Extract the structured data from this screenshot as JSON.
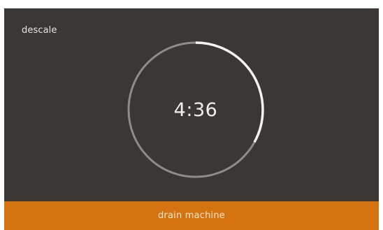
{
  "screen": {
    "title": "descale"
  },
  "timer": {
    "remaining": "4:36",
    "progress_fraction": 0.33,
    "ring_track_color": "#8f8b87",
    "ring_progress_color": "#f4f2ef"
  },
  "action": {
    "label": "drain machine",
    "color": "#d4730f"
  },
  "colors": {
    "background": "#3b3734",
    "text": "#e8e6e3"
  }
}
